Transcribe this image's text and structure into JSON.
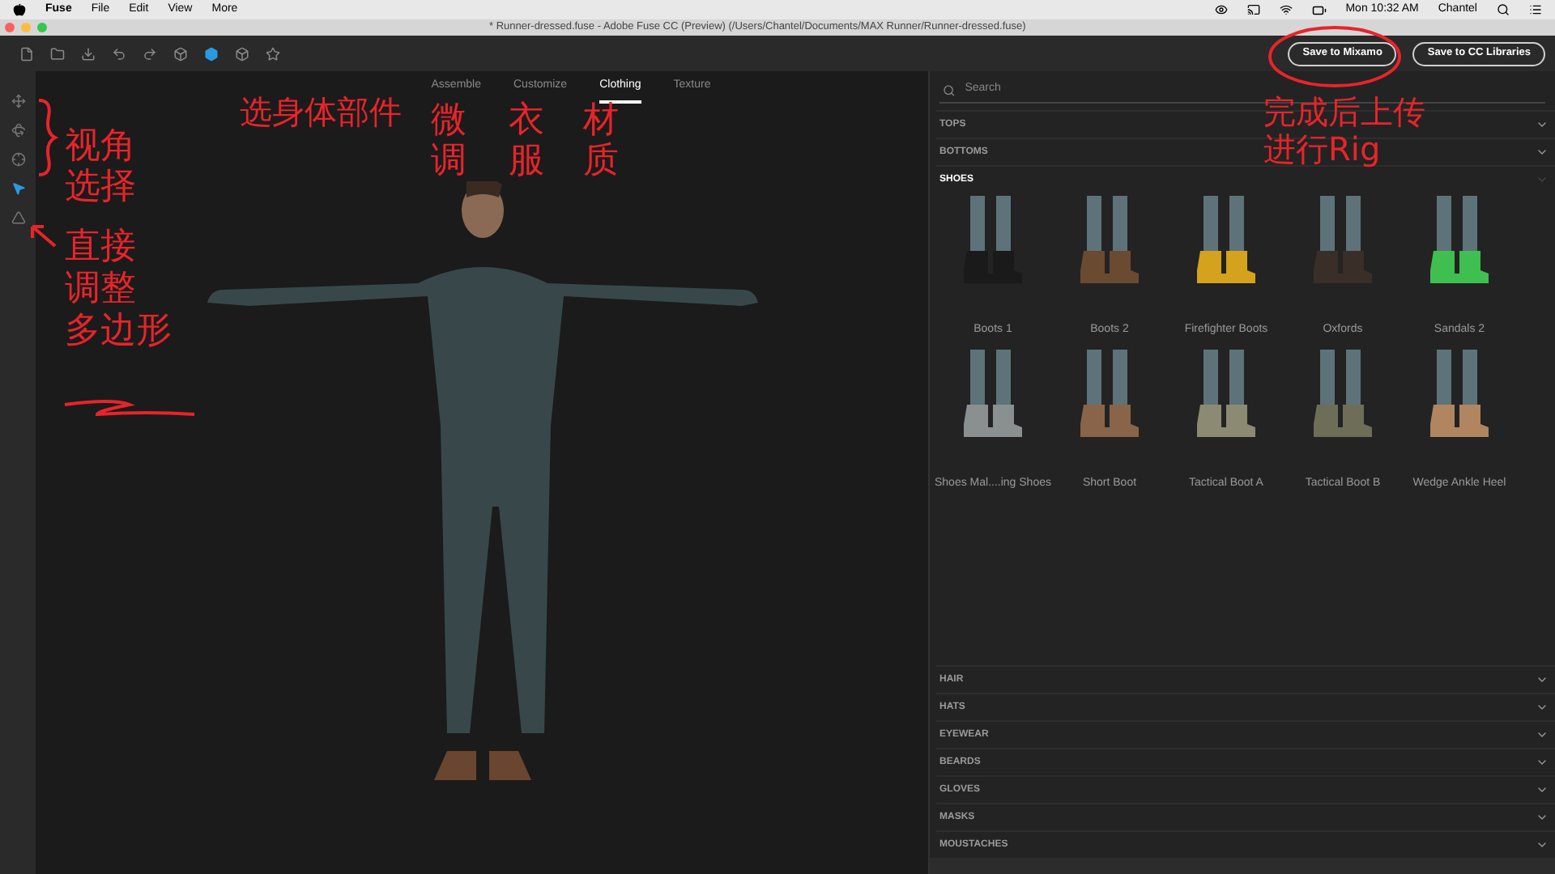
{
  "menu_bar": {
    "app": "Fuse",
    "items": [
      "File",
      "Edit",
      "View",
      "More"
    ],
    "clock": "Mon 10:32 AM",
    "user": "Chantel"
  },
  "window": {
    "title": "* Runner-dressed.fuse - Adobe Fuse CC (Preview) (/Users/Chantel/Documents/MAX Runner/Runner-dressed.fuse)"
  },
  "toolbar": {
    "tools": [
      {
        "kind": "page",
        "selected": false
      },
      {
        "kind": "folder",
        "selected": false
      },
      {
        "kind": "export",
        "selected": false
      },
      {
        "kind": "undo",
        "selected": false
      },
      {
        "kind": "redo",
        "selected": false
      },
      {
        "kind": "cube",
        "selected": false
      },
      {
        "kind": "cube",
        "selected": true
      },
      {
        "kind": "cube",
        "selected": false
      },
      {
        "kind": "star",
        "selected": false
      }
    ],
    "buttons": [
      "Save to Mixamo",
      "Save to CC Libraries"
    ]
  },
  "side_tools": [
    {
      "kind": "move",
      "selected": false
    },
    {
      "kind": "orbit",
      "selected": false
    },
    {
      "kind": "target",
      "selected": false
    },
    {
      "kind": "pointer",
      "selected": true
    },
    {
      "kind": "polygon",
      "selected": false
    }
  ],
  "tabs": [
    {
      "label": "Assemble",
      "selected": false
    },
    {
      "label": "Customize",
      "selected": false
    },
    {
      "label": "Clothing",
      "selected": true
    },
    {
      "label": "Texture",
      "selected": false
    }
  ],
  "annotations": [
    "视角选择",
    "直接",
    "调整",
    "多边形",
    "选身体部件",
    "微调",
    "衣服",
    "材质",
    "完成后上传进行Rig"
  ],
  "search": {
    "placeholder": "Search"
  },
  "categories": [
    {
      "label": "TOPS",
      "expanded": false
    },
    {
      "label": "BOTTOMS",
      "expanded": false
    },
    {
      "label": "SHOES",
      "expanded": true,
      "items": [
        {
          "label": "Boots 1",
          "color": "#1a1a1a"
        },
        {
          "label": "Boots 2",
          "color": "#6b4a32"
        },
        {
          "label": "Firefighter Boots",
          "color": "#d4a21c"
        },
        {
          "label": "Oxfords",
          "color": "#3a2e28"
        },
        {
          "label": "Sandals 2",
          "color": "#3fbf4f"
        },
        {
          "label": "Shoes Mal....ing Shoes",
          "color": "#8a9090"
        },
        {
          "label": "Short Boot",
          "color": "#8a6448"
        },
        {
          "label": "Tactical Boot A",
          "color": "#8c8a72"
        },
        {
          "label": "Tactical Boot B",
          "color": "#6e6e58"
        },
        {
          "label": "Wedge Ankle Heel",
          "color": "#b08560"
        }
      ]
    },
    {
      "label": "HAIR",
      "expanded": false
    },
    {
      "label": "HATS",
      "expanded": false
    },
    {
      "label": "EYEWEAR",
      "expanded": false
    },
    {
      "label": "BEARDS",
      "expanded": false
    },
    {
      "label": "GLOVES",
      "expanded": false
    },
    {
      "label": "MASKS",
      "expanded": false
    },
    {
      "label": "MOUSTACHES",
      "expanded": false
    }
  ]
}
